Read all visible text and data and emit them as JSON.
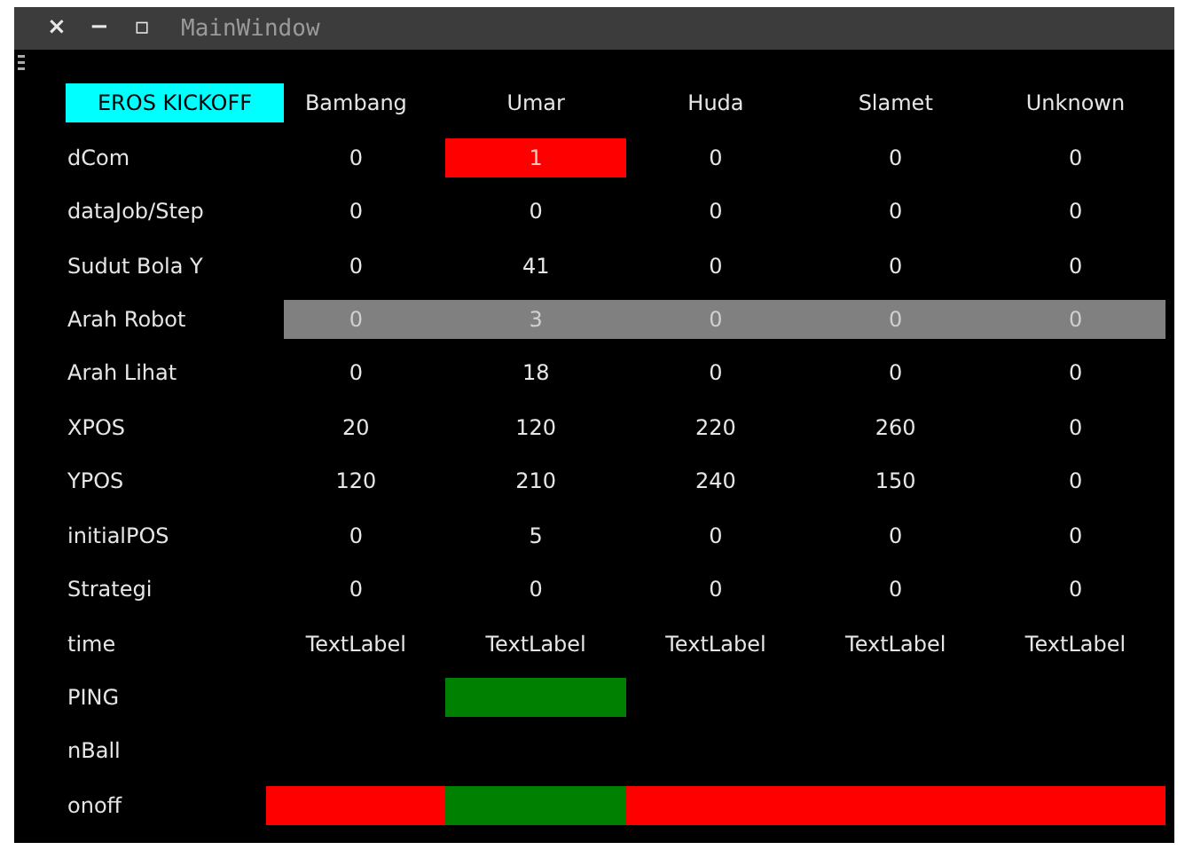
{
  "window": {
    "title": "MainWindow",
    "controls": [
      "×",
      "−",
      "▫"
    ]
  },
  "header": {
    "button": "EROS KICKOFF",
    "columns": [
      "Bambang",
      "Umar",
      "Huda",
      "Slamet",
      "Unknown"
    ]
  },
  "rows": [
    {
      "label": "dCom",
      "highlighted": false,
      "cells": [
        {
          "text": "0"
        },
        {
          "text": "1",
          "color": "#ff0000"
        },
        {
          "text": "0"
        },
        {
          "text": "0"
        },
        {
          "text": "0"
        }
      ]
    },
    {
      "label": "dataJob/Step",
      "highlighted": false,
      "cells": [
        {
          "text": "0"
        },
        {
          "text": "0"
        },
        {
          "text": "0"
        },
        {
          "text": "0"
        },
        {
          "text": "0"
        }
      ]
    },
    {
      "label": "Sudut Bola Y",
      "highlighted": false,
      "cells": [
        {
          "text": "0"
        },
        {
          "text": "41"
        },
        {
          "text": "0"
        },
        {
          "text": "0"
        },
        {
          "text": "0"
        }
      ]
    },
    {
      "label": "Arah Robot",
      "highlighted": true,
      "cells": [
        {
          "text": "0"
        },
        {
          "text": "3"
        },
        {
          "text": "0"
        },
        {
          "text": "0"
        },
        {
          "text": "0"
        }
      ]
    },
    {
      "label": "Arah Lihat",
      "highlighted": false,
      "cells": [
        {
          "text": "0"
        },
        {
          "text": "18"
        },
        {
          "text": "0"
        },
        {
          "text": "0"
        },
        {
          "text": "0"
        }
      ]
    },
    {
      "label": "XPOS",
      "highlighted": false,
      "cells": [
        {
          "text": "20"
        },
        {
          "text": "120"
        },
        {
          "text": "220"
        },
        {
          "text": "260"
        },
        {
          "text": "0"
        }
      ]
    },
    {
      "label": "YPOS",
      "highlighted": false,
      "cells": [
        {
          "text": "120"
        },
        {
          "text": "210"
        },
        {
          "text": "240"
        },
        {
          "text": "150"
        },
        {
          "text": "0"
        }
      ]
    },
    {
      "label": "initialPOS",
      "highlighted": false,
      "cells": [
        {
          "text": "0"
        },
        {
          "text": "5"
        },
        {
          "text": "0"
        },
        {
          "text": "0"
        },
        {
          "text": "0"
        }
      ]
    },
    {
      "label": "Strategi",
      "highlighted": false,
      "cells": [
        {
          "text": "0"
        },
        {
          "text": "0"
        },
        {
          "text": "0"
        },
        {
          "text": "0"
        },
        {
          "text": "0"
        }
      ]
    },
    {
      "label": "time",
      "highlighted": false,
      "cells": [
        {
          "text": "TextLabel"
        },
        {
          "text": "TextLabel"
        },
        {
          "text": "TextLabel"
        },
        {
          "text": "TextLabel"
        },
        {
          "text": "TextLabel"
        }
      ]
    },
    {
      "label": "PING",
      "highlighted": false,
      "cells": [
        {},
        {
          "color": "#008000"
        },
        {},
        {},
        {}
      ]
    },
    {
      "label": "nBall",
      "highlighted": false,
      "cells": []
    },
    {
      "label": "onoff",
      "highlighted": false,
      "cells": [
        {
          "color": "#ff0000"
        },
        {
          "color": "#008000"
        },
        {
          "color": "#ff0000"
        },
        {
          "color": "#ff0000"
        },
        {
          "color": "#ff0000"
        }
      ]
    }
  ]
}
